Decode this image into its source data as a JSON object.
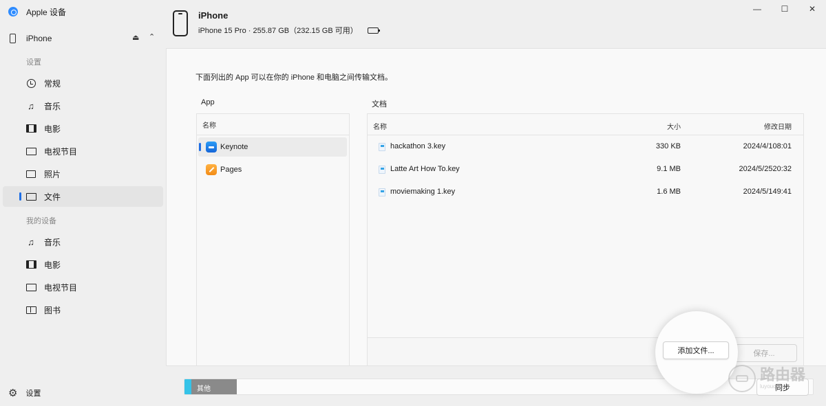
{
  "app": {
    "title": "Apple 设备"
  },
  "sidebar": {
    "device_name": "iPhone",
    "settings_section": "设置",
    "settings_items": [
      {
        "label": "常规",
        "icon": "clock-icon"
      },
      {
        "label": "音乐",
        "icon": "music-note-icon"
      },
      {
        "label": "电影",
        "icon": "film-icon"
      },
      {
        "label": "电视节目",
        "icon": "tv-icon"
      },
      {
        "label": "照片",
        "icon": "photo-icon"
      },
      {
        "label": "文件",
        "icon": "folder-icon",
        "active": true
      }
    ],
    "my_device_section": "我的设备",
    "device_items": [
      {
        "label": "音乐",
        "icon": "music-note-icon"
      },
      {
        "label": "电影",
        "icon": "film-icon"
      },
      {
        "label": "电视节目",
        "icon": "tv-icon"
      },
      {
        "label": "图书",
        "icon": "book-icon"
      }
    ],
    "settings_label": "设置"
  },
  "header": {
    "device_name": "iPhone",
    "device_info": "iPhone 15 Pro · 255.87 GB（232.15 GB 可用）",
    "battery_color": "#36c23a"
  },
  "main": {
    "description": "下面列出的 App 可以在你的 iPhone 和电脑之间传输文档。",
    "app_column_title": "App",
    "app_header_name": "名称",
    "apps": [
      {
        "name": "Keynote",
        "icon": "keynote-icon",
        "selected": true
      },
      {
        "name": "Pages",
        "icon": "pages-icon"
      }
    ],
    "docs_column_title": "文档",
    "docs_header": {
      "name": "名称",
      "size": "大小",
      "modified": "修改日期"
    },
    "documents": [
      {
        "name": "hackathon 3.key",
        "size": "330 KB",
        "modified": "2024/4/108:01"
      },
      {
        "name": "Latte Art How To.key",
        "size": "9.1 MB",
        "modified": "2024/5/2520:32"
      },
      {
        "name": "moviemaking 1.key",
        "size": "1.6 MB",
        "modified": "2024/5/149:41"
      }
    ],
    "add_file_label": "添加文件...",
    "save_label": "保存..."
  },
  "bottom": {
    "storage_other_label": "其他",
    "sync_label": "同步"
  },
  "watermark": {
    "cn": "路由器",
    "en": "luyouqi.com"
  },
  "colors": {
    "accent": "#1f6fe5",
    "storage_blue": "#35c3e8",
    "storage_other": "#8a8a8a"
  }
}
